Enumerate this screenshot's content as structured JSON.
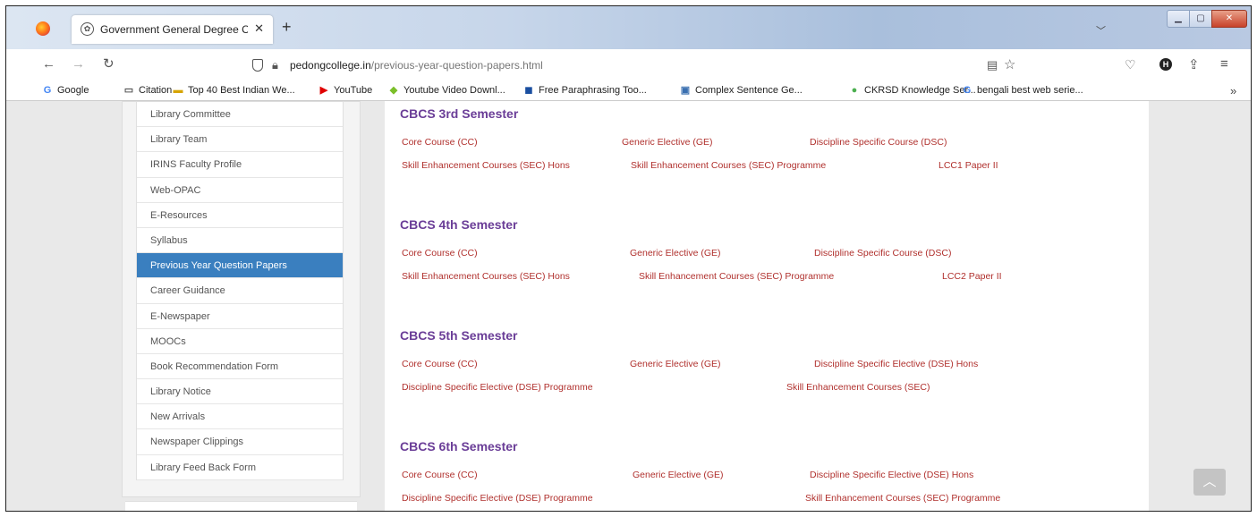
{
  "browser": {
    "tab_title": "Government General Degree Co",
    "tab_close": "✕",
    "new_tab": "+",
    "url_host": "pedongcollege.in",
    "url_path": "/previous-year-question-papers.html"
  },
  "bookmarks": [
    {
      "icon": "G",
      "color": "#4285f4",
      "label": "Google"
    },
    {
      "icon": "▭",
      "color": "#555555",
      "label": "Citation"
    },
    {
      "icon": "▬",
      "color": "#d6a400",
      "label": "Top 40 Best Indian We..."
    },
    {
      "icon": "▶",
      "color": "#e00000",
      "label": "YouTube"
    },
    {
      "icon": "◆",
      "color": "#7bbf2a",
      "label": "Youtube Video Downl..."
    },
    {
      "icon": "◼",
      "color": "#1a4fa0",
      "label": "Free Paraphrasing Too..."
    },
    {
      "icon": "▣",
      "color": "#3a6fb0",
      "label": "Complex Sentence Ge..."
    },
    {
      "icon": "●",
      "color": "#4caf50",
      "label": "CKRSD Knowledge Ser..."
    },
    {
      "icon": "G",
      "color": "#4285f4",
      "label": "bengali best web serie..."
    }
  ],
  "sidebar": {
    "items": [
      {
        "label": "Library Committee",
        "active": false
      },
      {
        "label": "Library Team",
        "active": false
      },
      {
        "label": "IRINS Faculty Profile",
        "active": false
      },
      {
        "label": "Web-OPAC",
        "active": false
      },
      {
        "label": "E-Resources",
        "active": false
      },
      {
        "label": "Syllabus",
        "active": false
      },
      {
        "label": "Previous Year Question Papers",
        "active": true
      },
      {
        "label": "Career Guidance",
        "active": false
      },
      {
        "label": "E-Newspaper",
        "active": false
      },
      {
        "label": "MOOCs",
        "active": false
      },
      {
        "label": "Book Recommendation Form",
        "active": false
      },
      {
        "label": "Library Notice",
        "active": false
      },
      {
        "label": "New Arrivals",
        "active": false
      },
      {
        "label": "Newspaper Clippings",
        "active": false
      },
      {
        "label": "Library Feed Back Form",
        "active": false
      }
    ]
  },
  "semesters": [
    {
      "title": "CBCS 3rd Semester",
      "rows": [
        [
          "Core Course (CC)",
          "Generic Elective (GE)",
          "Discipline Specific Course (DSC)"
        ],
        [
          "Skill Enhancement Courses (SEC) Hons",
          "Skill Enhancement Courses (SEC) Programme",
          "LCC1 Paper II"
        ]
      ]
    },
    {
      "title": "CBCS 4th Semester",
      "rows": [
        [
          "Core Course (CC)",
          "Generic Elective (GE)",
          "Discipline Specific Course (DSC)"
        ],
        [
          "Skill Enhancement Courses (SEC) Hons",
          "Skill Enhancement Courses (SEC) Programme",
          "LCC2 Paper II"
        ]
      ]
    },
    {
      "title": "CBCS 5th Semester",
      "rows": [
        [
          "Core Course (CC)",
          "Generic Elective (GE)",
          "Discipline Specific Elective (DSE) Hons"
        ],
        [
          "Discipline Specific Elective (DSE) Programme",
          "Skill Enhancement Courses (SEC)"
        ]
      ]
    },
    {
      "title": "CBCS 6th Semester",
      "rows": [
        [
          "Core Course (CC)",
          "Generic Elective (GE)",
          "Discipline Specific Elective (DSE) Hons"
        ],
        [
          "Discipline Specific Elective (DSE) Programme",
          "Skill Enhancement Courses (SEC) Programme"
        ]
      ]
    }
  ],
  "scroll_top_icon": "chevron-up-icon"
}
